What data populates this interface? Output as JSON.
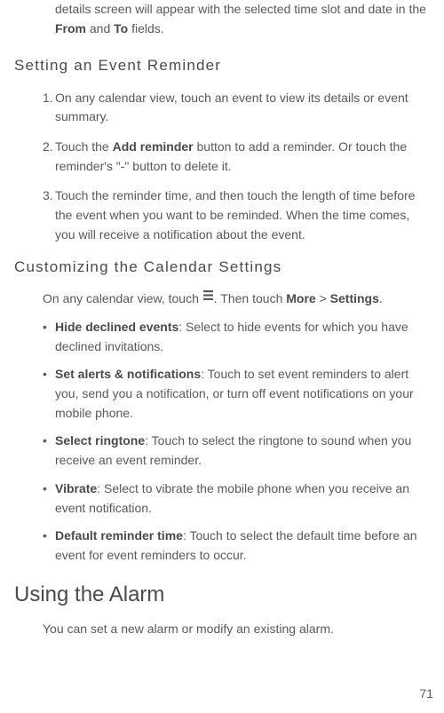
{
  "intro": {
    "text_before_from": "details screen will appear with the selected time slot and date in the ",
    "from_label": "From",
    "and_text": " and ",
    "to_label": "To",
    "fields_text": " fields."
  },
  "section1": {
    "heading": "Setting an Event Reminder",
    "items": [
      {
        "num": "1.",
        "text": "On any calendar view, touch an event to view its details or event summary."
      },
      {
        "num": "2.",
        "text_before": "Touch the ",
        "bold": "Add reminder",
        "text_after": " button to add a reminder. Or touch the reminder's \"-\" button to delete it."
      },
      {
        "num": "3.",
        "text": "Touch the reminder time, and then touch the length of time before the event when you want to be reminded. When the time comes, you will receive a notification about the event."
      }
    ]
  },
  "section2": {
    "heading": "Customizing the Calendar Settings",
    "intro": {
      "text_before": "On any calendar view, touch ",
      "text_mid": ". Then touch ",
      "more_label": "More",
      "gt": " > ",
      "settings_label": "Settings",
      "period": "."
    },
    "bullets": [
      {
        "bold": "Hide declined events",
        "text": ": Select to hide events for which you have declined invitations."
      },
      {
        "bold": "Set alerts & notifications",
        "text": ": Touch to set event reminders to alert you, send you a notification, or turn off event notifications on your mobile phone."
      },
      {
        "bold": "Select ringtone",
        "text": ": Touch to select the ringtone to sound when you receive an event reminder."
      },
      {
        "bold": "Vibrate",
        "text": ": Select to vibrate the mobile phone when you receive an event notification."
      },
      {
        "bold": "Default reminder time",
        "text": ": Touch to select the default time before an event for event reminders to occur."
      }
    ]
  },
  "section3": {
    "heading": "Using the Alarm",
    "body": "You can set a new alarm or modify an existing alarm."
  },
  "page_number": "71",
  "bullet_char": "•"
}
